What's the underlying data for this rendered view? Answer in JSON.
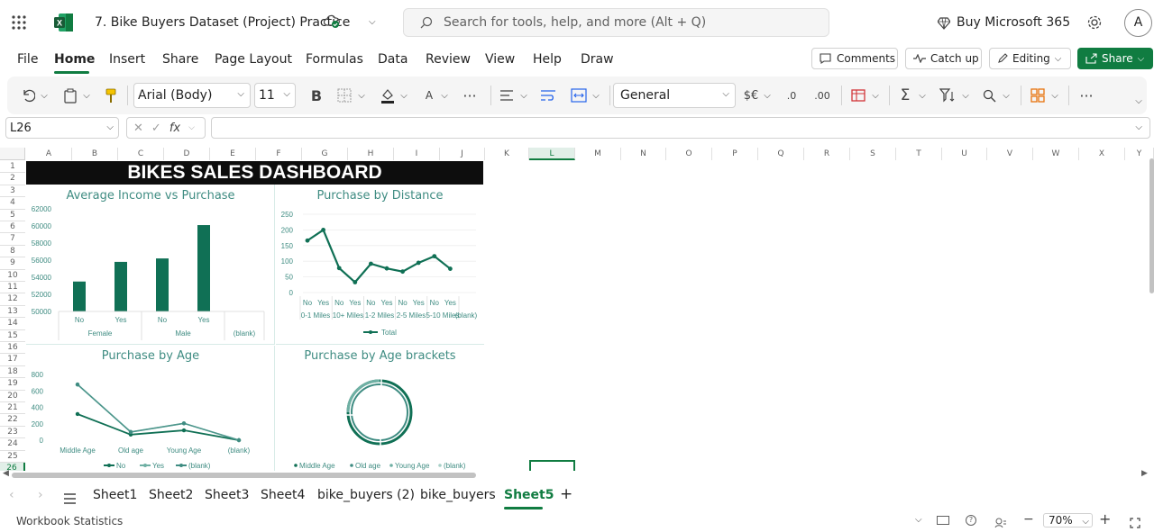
{
  "app": {
    "file_title": "7. Bike Buyers Dataset (Project) Practice",
    "search_placeholder": "Search for tools, help, and more (Alt + Q)",
    "buy_label": "Buy Microsoft 365",
    "avatar_letter": "A"
  },
  "menu": {
    "items": [
      "File",
      "Home",
      "Insert",
      "Share",
      "Page Layout",
      "Formulas",
      "Data",
      "Review",
      "View",
      "Help",
      "Draw"
    ],
    "comments_label": "Comments",
    "catchup_label": "Catch up",
    "editing_label": "Editing",
    "share_label": "Share"
  },
  "ribbon": {
    "font_name": "Arial (Body)",
    "font_size": "11",
    "number_format": "General",
    "bold": "B",
    "currency": "$€",
    "dec_inc": ".0",
    "dec_dec": ".00"
  },
  "formula_bar": {
    "name_box": "L26",
    "fx": "fx",
    "formula": ""
  },
  "grid": {
    "columns": [
      "A",
      "B",
      "C",
      "D",
      "E",
      "F",
      "G",
      "H",
      "I",
      "J",
      "K",
      "L",
      "M",
      "N",
      "O",
      "P",
      "Q",
      "R",
      "S",
      "T",
      "U",
      "V",
      "W",
      "X",
      "Y"
    ],
    "rows": [
      "1",
      "2",
      "3",
      "4",
      "5",
      "6",
      "7",
      "8",
      "9",
      "10",
      "11",
      "12",
      "13",
      "14",
      "15",
      "16",
      "17",
      "18",
      "19",
      "20",
      "21",
      "22",
      "23",
      "24",
      "25",
      "26"
    ],
    "selected_col": "L",
    "selected_row": "26"
  },
  "dashboard": {
    "title": "BIKES SALES DASHBOARD",
    "colors": {
      "dark": "#107055",
      "mid": "#3f8c82",
      "light": "#6fb0a4"
    }
  },
  "chart_data": [
    {
      "type": "bar",
      "title": "Average Income vs Purchase",
      "categories": [
        "No",
        "Yes",
        "No",
        "Yes"
      ],
      "groups": [
        "Female",
        "Male",
        "(blank)"
      ],
      "values": [
        53500,
        55800,
        56200,
        60100
      ],
      "yticks": [
        "62000",
        "60000",
        "58000",
        "56000",
        "54000",
        "52000",
        "50000"
      ],
      "ylim": [
        50000,
        62000
      ]
    },
    {
      "type": "line",
      "title": "Purchase by Distance",
      "x": [
        "No",
        "Yes",
        "No",
        "Yes",
        "No",
        "Yes",
        "No",
        "Yes",
        "No",
        "Yes"
      ],
      "groups": [
        "0-1 Miles",
        "10+ Miles",
        "1-2 Miles",
        "2-5 Miles",
        "5-10 Miles",
        "(blank)"
      ],
      "values": [
        166,
        200,
        78,
        33,
        92,
        77,
        67,
        95,
        116,
        76
      ],
      "yticks": [
        "250",
        "200",
        "150",
        "100",
        "50",
        "0"
      ],
      "ylim": [
        0,
        250
      ],
      "legend": "Total"
    },
    {
      "type": "line",
      "title": "Purchase by Age",
      "categories": [
        "Middle Age",
        "Old age",
        "Young Age",
        "(blank)"
      ],
      "series": [
        {
          "name": "No",
          "values": [
            318,
            68,
            120,
            0
          ]
        },
        {
          "name": "Yes",
          "values": [
            678,
            100,
            205,
            0
          ]
        },
        {
          "name": "(blank)",
          "values": [
            678,
            100,
            205,
            0
          ]
        }
      ],
      "yticks": [
        "800",
        "600",
        "400",
        "200",
        "0"
      ],
      "ylim": [
        0,
        800
      ]
    },
    {
      "type": "pie",
      "title": "Purchase by Age brackets",
      "legend": [
        "Middle Age",
        "Old age",
        "Young Age",
        "(blank)"
      ]
    }
  ],
  "sheets": {
    "tabs": [
      "Sheet1",
      "Sheet2",
      "Sheet3",
      "Sheet4",
      "bike_buyers (2)",
      "bike_buyers",
      "Sheet5"
    ],
    "active": "Sheet5"
  },
  "status": {
    "left": "Workbook Statistics",
    "zoom": "70%"
  }
}
